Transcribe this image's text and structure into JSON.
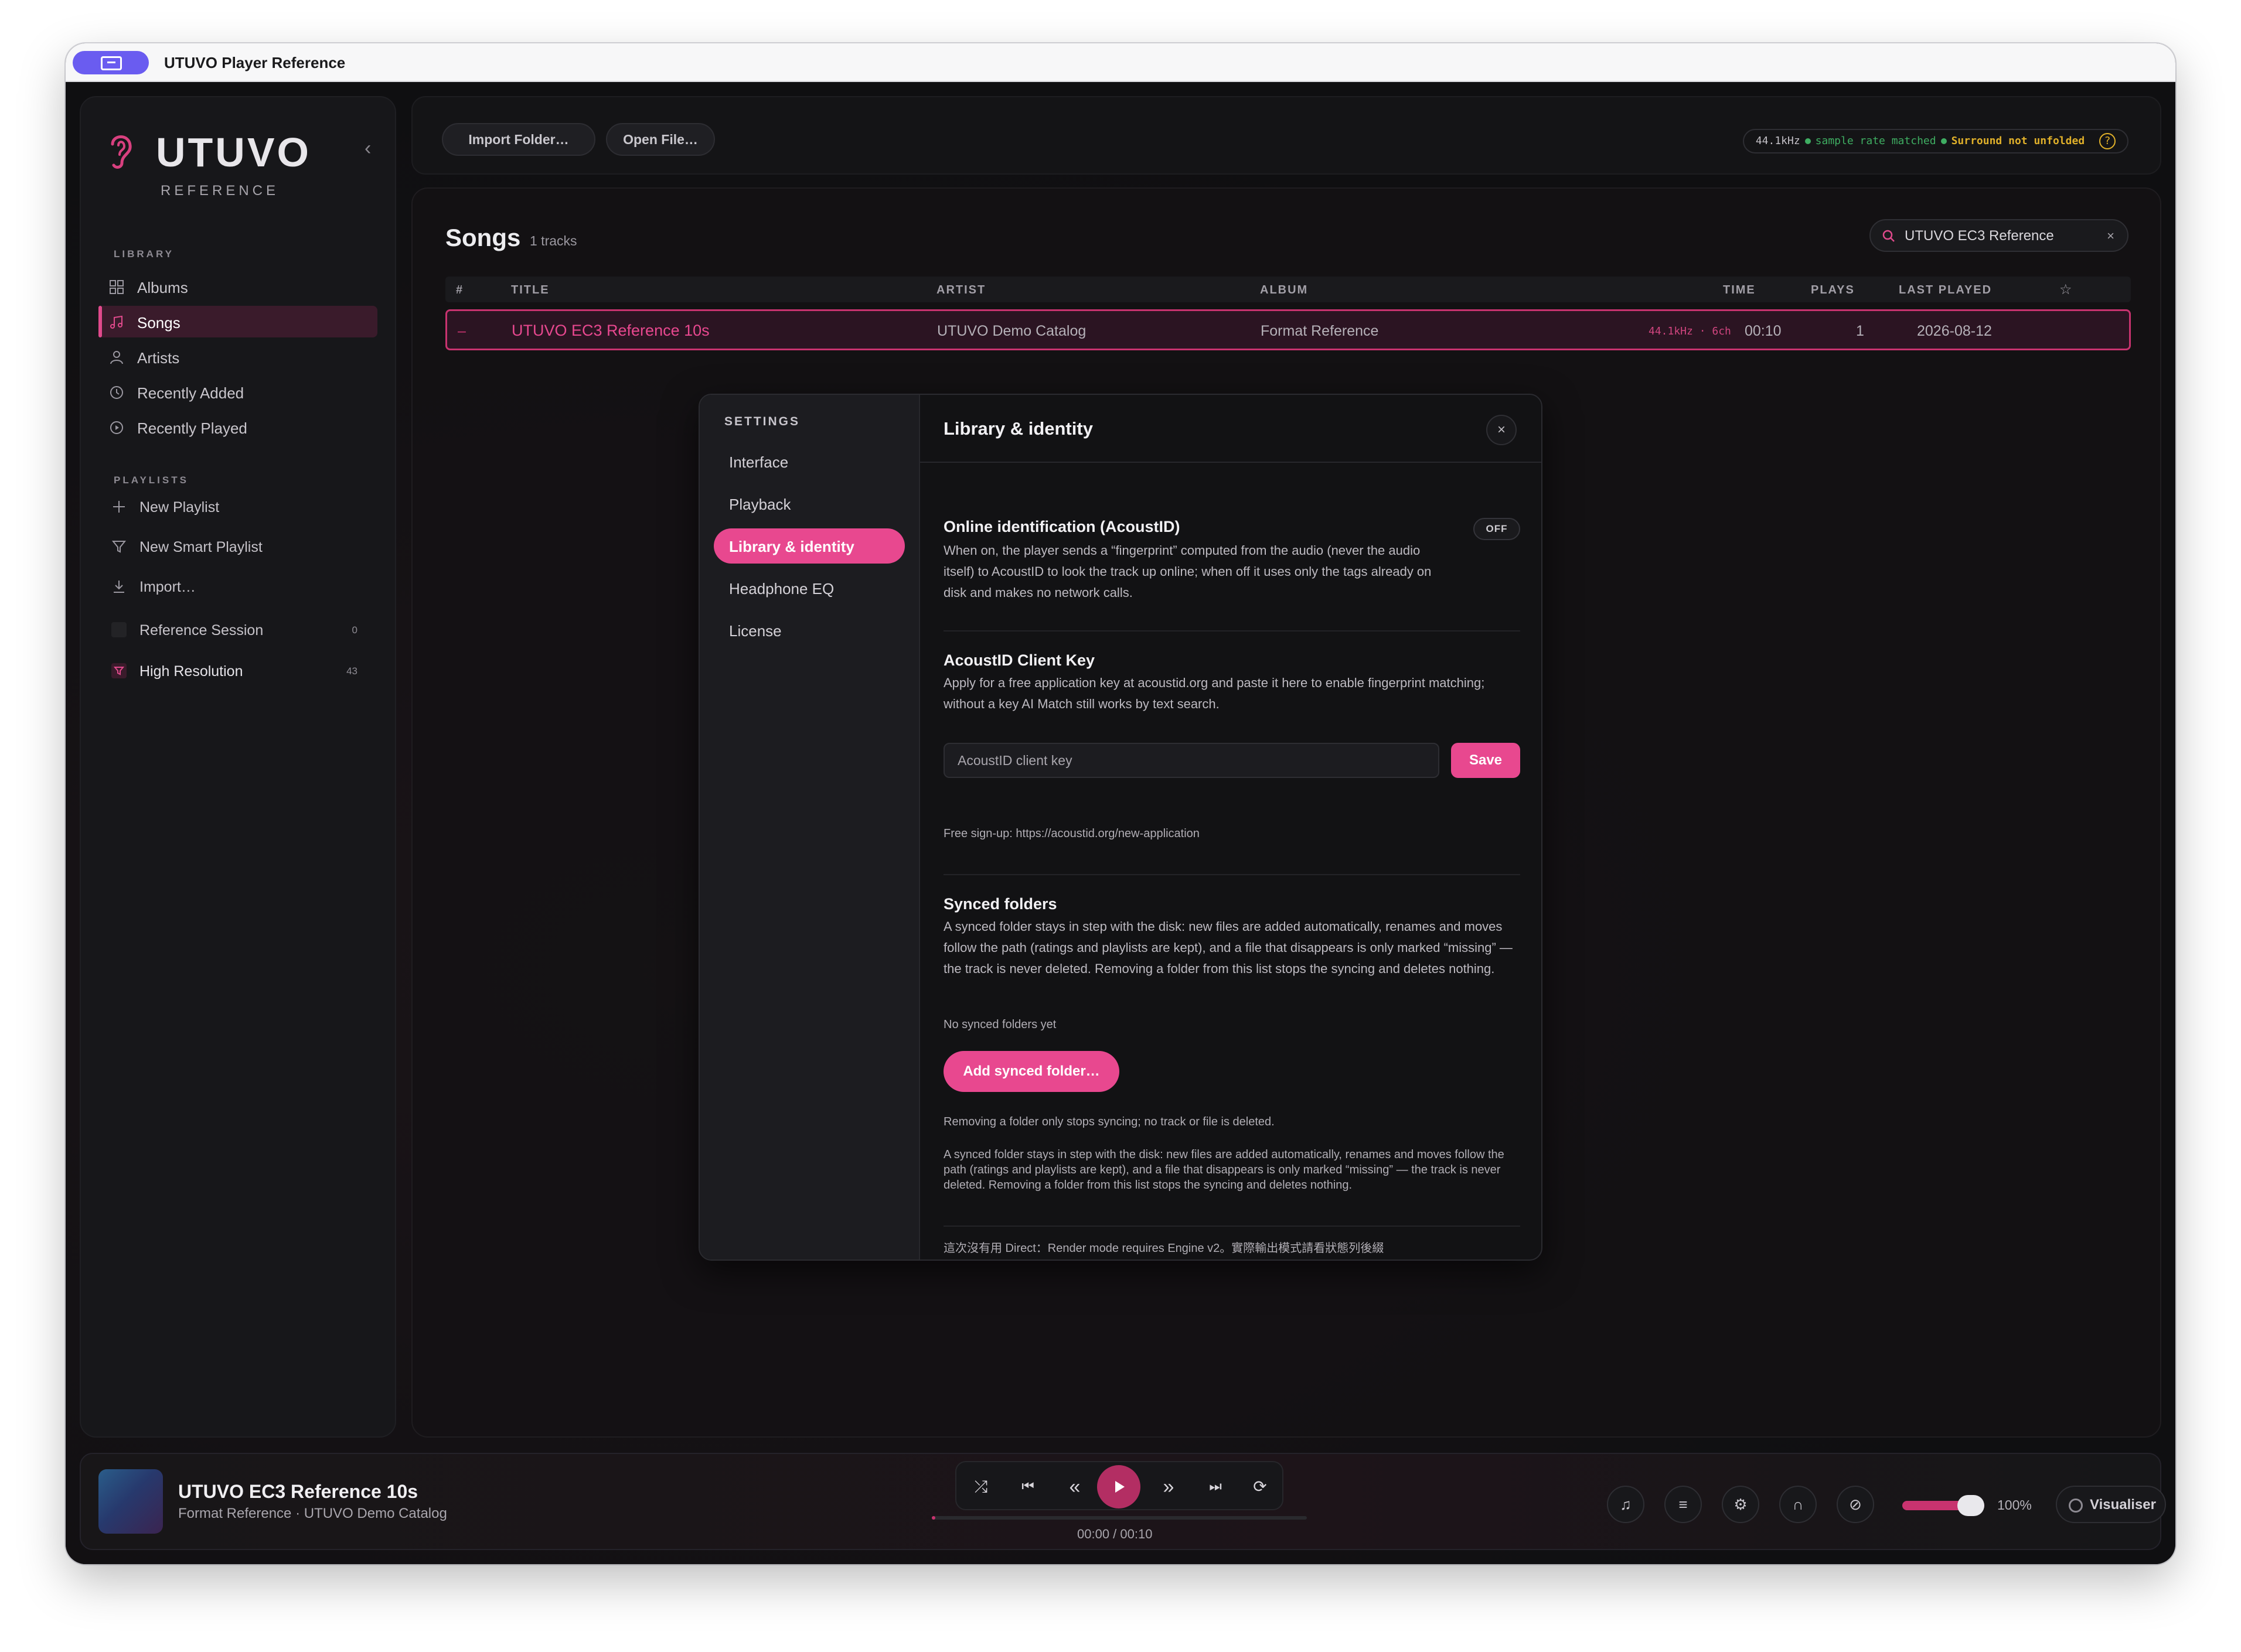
{
  "window": {
    "title": "UTUVO Player Reference"
  },
  "sidebar": {
    "logo": "UTUVO",
    "logo_sub": "REFERENCE",
    "collapse_glyph": "‹",
    "library_label": "LIBRARY",
    "library_items": [
      {
        "label": "Albums",
        "icon": "grid-icon"
      },
      {
        "label": "Songs",
        "icon": "music-note-icon",
        "active": true
      },
      {
        "label": "Artists",
        "icon": "person-icon"
      },
      {
        "label": "Recently Added",
        "icon": "clock-icon"
      },
      {
        "label": "Recently Played",
        "icon": "play-circle-icon"
      }
    ],
    "playlists_label": "PLAYLISTS",
    "playlist_actions": [
      {
        "label": "New Playlist",
        "icon": "plus-icon"
      },
      {
        "label": "New Smart Playlist",
        "icon": "filter-icon"
      },
      {
        "label": "Import…",
        "icon": "download-icon"
      }
    ],
    "playlists": [
      {
        "label": "Reference Session",
        "count": "0"
      },
      {
        "label": "High Resolution",
        "count": "43"
      }
    ]
  },
  "topbar": {
    "import_folder": "Import Folder…",
    "open_file": "Open File…",
    "status": {
      "rate": "44.1kHz",
      "rate_msg": "sample rate matched",
      "surround_msg": "Surround not unfolded",
      "help": "?"
    }
  },
  "songs": {
    "title": "Songs",
    "count": "1 tracks",
    "search_value": "UTUVO EC3 Reference",
    "search_clear": "×",
    "columns": {
      "num": "#",
      "title": "TITLE",
      "artist": "ARTIST",
      "album": "ALBUM",
      "time": "TIME",
      "plays": "PLAYS",
      "last_played": "LAST PLAYED",
      "star": "☆"
    },
    "rows": [
      {
        "num": "–",
        "title": "UTUVO EC3 Reference 10s",
        "artist": "UTUVO Demo Catalog",
        "album": "Format Reference",
        "format": "44.1kHz · 6ch",
        "time": "00:10",
        "plays": "1",
        "last_played": "2026-08-12"
      }
    ]
  },
  "settings": {
    "label": "SETTINGS",
    "nav": [
      "Interface",
      "Playback",
      "Library & identity",
      "Headphone EQ",
      "License"
    ],
    "active_index": 2,
    "title": "Library & identity",
    "close": "×",
    "online_id": {
      "title": "Online identification (AcoustID)",
      "toggle": "OFF",
      "desc": "When on, the player sends a “fingerprint” computed from the audio (never the audio itself) to AcoustID to look the track up online; when off it uses only the tags already on disk and makes no network calls."
    },
    "client_key": {
      "title": "AcoustID Client Key",
      "desc": "Apply for a free application key at acoustid.org and paste it here to enable fingerprint matching; without a key AI Match still works by text search.",
      "placeholder": "AcoustID client key",
      "save": "Save",
      "signup": "Free sign-up: https://acoustid.org/new-application"
    },
    "synced": {
      "title": "Synced folders",
      "desc": "A synced folder stays in step with the disk: new files are added automatically, renames and moves follow the path (ratings and playlists are kept), and a file that disappears is only marked “missing” — the track is never deleted. Removing a folder from this list stops the syncing and deletes nothing.",
      "empty": "No synced folders yet",
      "add": "Add synced folder…",
      "note": "Removing a folder only stops syncing; no track or file is deleted.",
      "desc_repeat": "A synced folder stays in step with the disk: new files are added automatically, renames and moves follow the path (ratings and playlists are kept), and a file that disappears is only marked “missing” — the track is never deleted. Removing a folder from this list stops the syncing and deletes nothing."
    },
    "footer_note": "這次沒有用 Direct：Render mode requires Engine v2。實際輸出模式請看狀態列後綴"
  },
  "player": {
    "title": "UTUVO EC3 Reference 10s",
    "subtitle": "Format Reference · UTUVO Demo Catalog",
    "time": "00:00 / 00:10",
    "progress": 0.01,
    "volume_label": "100%",
    "volume": 1.0,
    "visualiser": "Visualiser",
    "controls": [
      {
        "name": "shuffle-icon",
        "glyph": "⤮"
      },
      {
        "name": "previous-track-icon",
        "glyph": "⏮"
      },
      {
        "name": "rewind-icon",
        "glyph": "«"
      },
      {
        "name": "fast-forward-icon",
        "glyph": "»"
      },
      {
        "name": "next-track-icon",
        "glyph": "⏭"
      },
      {
        "name": "repeat-icon",
        "glyph": "⟳"
      }
    ],
    "right_icons": [
      {
        "name": "lyrics-note-icon",
        "glyph": "♫"
      },
      {
        "name": "queue-icon",
        "glyph": "≡"
      },
      {
        "name": "settings-gear-icon",
        "glyph": "⚙"
      },
      {
        "name": "headphones-icon",
        "glyph": "∩"
      },
      {
        "name": "mute-speaker-icon",
        "glyph": "⊘"
      }
    ]
  },
  "colors": {
    "accent": "#e8488f",
    "accent_dark": "#b32e63",
    "green": "#3fae62",
    "amber": "#e0b02a"
  }
}
